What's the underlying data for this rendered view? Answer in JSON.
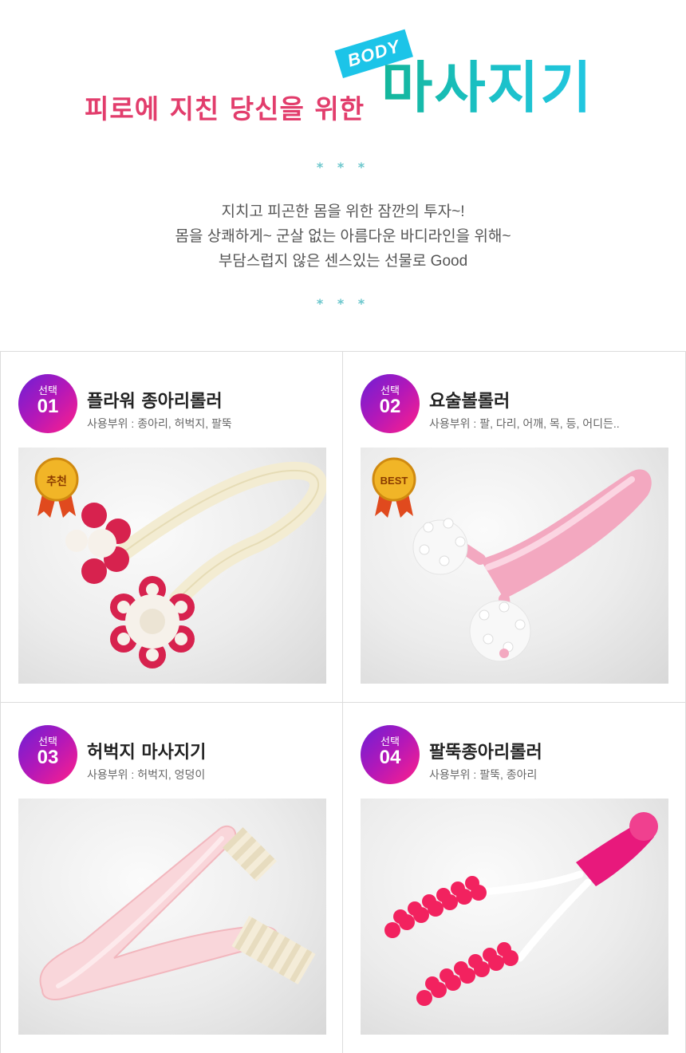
{
  "header": {
    "subtitle": "피로에 지친 당신을 위한",
    "tag": "BODY",
    "title": "마사지기",
    "stars": "* * *",
    "description": [
      "지치고 피곤한 몸을 위한 잠깐의 투자~!",
      "몸을 상쾌하게~ 군살 없는 아름다운 바디라인을 위해~",
      "부담스럽지 않은 센스있는 선물로 Good"
    ]
  },
  "products": [
    {
      "badge_label": "선택",
      "number": "01",
      "name": "플라워 종아리롤러",
      "usage": "사용부위 : 종아리, 허벅지, 팔뚝",
      "ribbon": "추천"
    },
    {
      "badge_label": "선택",
      "number": "02",
      "name": "요술볼롤러",
      "usage": "사용부위 : 팔, 다리, 어깨, 목, 등, 어디든..",
      "ribbon": "BEST"
    },
    {
      "badge_label": "선택",
      "number": "03",
      "name": "허벅지 마사지기",
      "usage": "사용부위 : 허벅지, 엉덩이"
    },
    {
      "badge_label": "선택",
      "number": "04",
      "name": "팔뚝종아리롤러",
      "usage": "사용부위 : 팔뚝, 종아리"
    }
  ],
  "colors": {
    "subtitle": "#e23d6c",
    "tag_bg": "#1cc4e8",
    "title_gradient_start": "#14b69a",
    "title_gradient_end": "#22c7e2",
    "badge_gradient_start": "#6b1fd6",
    "badge_gradient_end": "#ff1f8a"
  }
}
